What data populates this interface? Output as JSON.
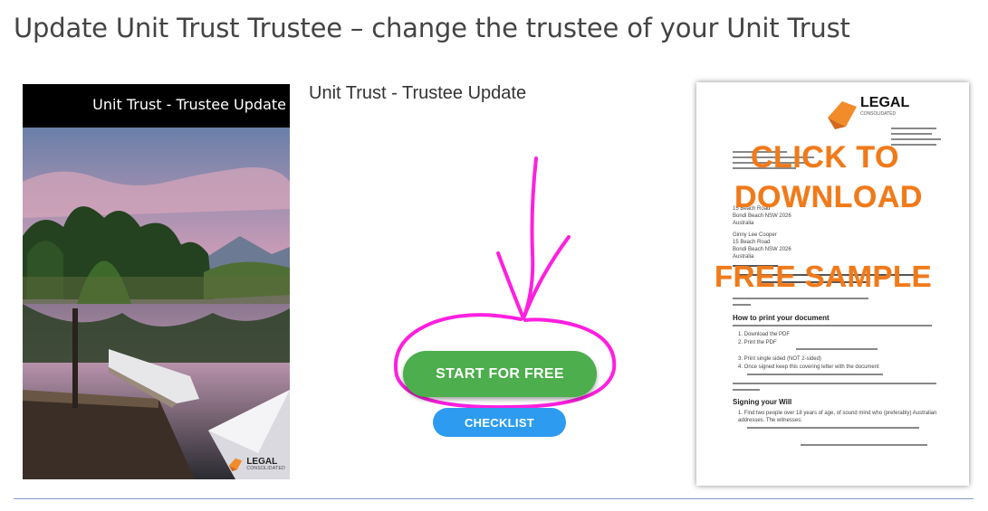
{
  "page": {
    "title": "Update Unit Trust Trustee – change the trustee of your Unit Trust"
  },
  "cover": {
    "title": "Unit Trust - Trustee Update",
    "logo_line1": "LEGAL",
    "logo_line2": "CONSOLIDATED"
  },
  "product": {
    "name": "Unit Trust - Trustee Update"
  },
  "buttons": {
    "start_label": "START FOR FREE",
    "checklist_label": "CHECKLIST"
  },
  "sample": {
    "logo_line1": "LEGAL",
    "logo_line2": "CONSOLIDATED",
    "overlay_line1": "CLICK TO",
    "overlay_line2": "DOWNLOAD",
    "overlay_line3": "FREE SAMPLE",
    "doc_heading_print": "How to print your document",
    "doc_heading_signing": "Signing your Will",
    "addr_1": "15 Beach Road",
    "addr_2": "Bondi Beach NSW 2026",
    "addr_3": "Australia",
    "name_line": "Ginny Lee Cooper",
    "step_1": "1.  Download the PDF",
    "step_2": "2.  Print the PDF",
    "step_3": "3.  Print single sided (NOT 2-sided)",
    "step_4": "4.  Once signed keep this covering letter with the document",
    "signing_1": "1.  Find two people over 18 years of age, of sound mind who (preferably) Australian",
    "signing_2": "     addresses. The witnesses:"
  },
  "colors": {
    "start_button": "#4cae4c",
    "checklist_button": "#2d9cf0",
    "overlay_orange": "#f07a1a",
    "annotation_magenta": "#ff1fe0",
    "divider": "#7f99c7"
  }
}
